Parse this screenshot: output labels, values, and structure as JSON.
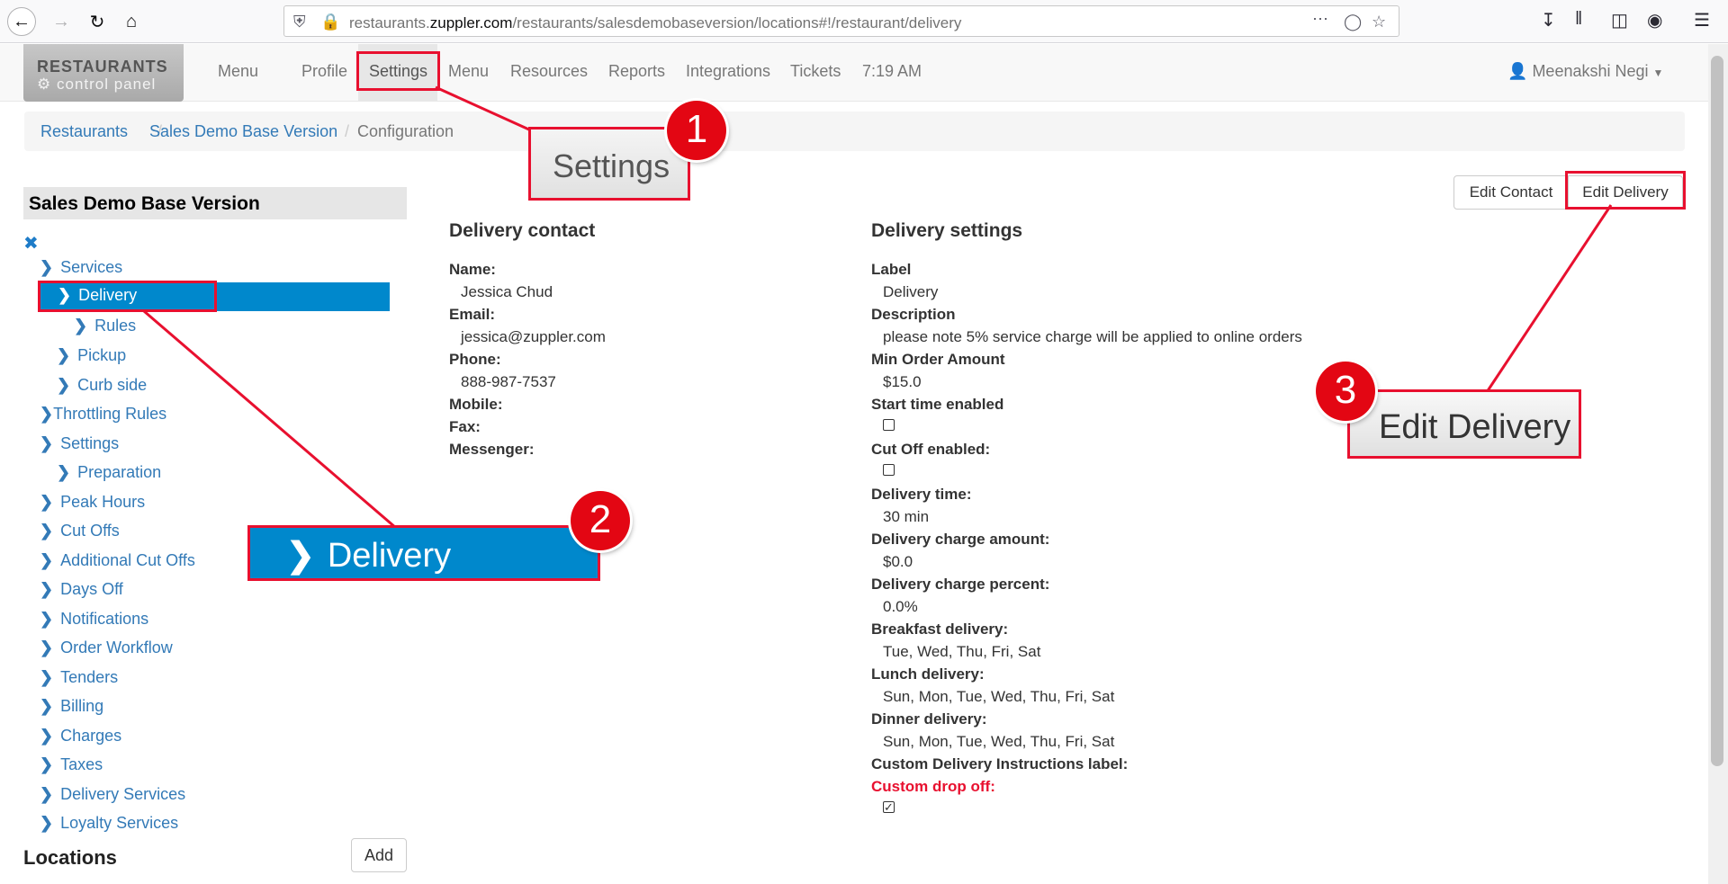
{
  "browser": {
    "url_prefix": "restaurants.",
    "url_domain": "zuppler.com",
    "url_path": "/restaurants/salesdemobaseversion/locations#!/restaurant/delivery"
  },
  "nav": {
    "brand_title": "RESTAURANTS",
    "brand_sub": "control panel",
    "items": [
      "Menu",
      "Profile",
      "Settings",
      "Menu",
      "Resources",
      "Reports",
      "Integrations",
      "Tickets"
    ],
    "time": "7:19 AM",
    "user": "Meenakshi Negi"
  },
  "breadcrumb": {
    "items": [
      "Restaurants",
      "Sales Demo Base Version",
      "Configuration"
    ],
    "separator": "/"
  },
  "sidebar": {
    "title": "Sales Demo Base Version",
    "items": [
      {
        "label": "Services"
      },
      {
        "label": "Delivery"
      },
      {
        "label": "Rules"
      },
      {
        "label": "Pickup"
      },
      {
        "label": "Curb side"
      },
      {
        "label": "Throttling Rules"
      },
      {
        "label": "Settings"
      },
      {
        "label": "Preparation"
      },
      {
        "label": "Peak Hours"
      },
      {
        "label": "Cut Offs"
      },
      {
        "label": "Additional Cut Offs"
      },
      {
        "label": "Days Off"
      },
      {
        "label": "Notifications"
      },
      {
        "label": "Order Workflow"
      },
      {
        "label": "Tenders"
      },
      {
        "label": "Billing"
      },
      {
        "label": "Charges"
      },
      {
        "label": "Taxes"
      },
      {
        "label": "Delivery Services"
      },
      {
        "label": "Loyalty Services"
      }
    ],
    "locations_title": "Locations",
    "add_label": "Add"
  },
  "contact": {
    "title": "Delivery contact",
    "fields": [
      {
        "label": "Name:",
        "value": "Jessica Chud"
      },
      {
        "label": "Email:",
        "value": "jessica@zuppler.com"
      },
      {
        "label": "Phone:",
        "value": "888-987-7537"
      },
      {
        "label": "Mobile:",
        "value": ""
      },
      {
        "label": "Fax:",
        "value": ""
      },
      {
        "label": "Messenger:",
        "value": ""
      }
    ]
  },
  "settings": {
    "title": "Delivery settings",
    "fields": [
      {
        "label": "Label",
        "value": "Delivery"
      },
      {
        "label": "Description",
        "value": "please note 5% service charge will be applied to online orders"
      },
      {
        "label": "Min Order Amount",
        "value": "$15.0"
      },
      {
        "label": "Start time enabled",
        "checked": false
      },
      {
        "label": "Cut Off enabled:",
        "checked": false
      },
      {
        "label": "Delivery time:",
        "value": "30 min"
      },
      {
        "label": "Delivery charge amount:",
        "value": "$0.0"
      },
      {
        "label": "Delivery charge percent:",
        "value": "0.0%"
      },
      {
        "label": "Breakfast delivery:",
        "value": "Tue, Wed, Thu, Fri, Sat"
      },
      {
        "label": "Lunch delivery:",
        "value": "Sun, Mon, Tue, Wed, Thu, Fri, Sat"
      },
      {
        "label": "Dinner delivery:",
        "value": "Sun, Mon, Tue, Wed, Thu, Fri, Sat"
      },
      {
        "label": "Custom Delivery Instructions label:",
        "value": ""
      },
      {
        "label": "Custom drop off:",
        "checked": true
      }
    ]
  },
  "actions": {
    "edit_contact": "Edit Contact",
    "edit_delivery": "Edit Delivery"
  },
  "annotations": {
    "callout_1": "Settings",
    "callout_2": "Delivery",
    "callout_3": "Edit Delivery",
    "badges": [
      "1",
      "2",
      "3"
    ],
    "color": "#e8102f"
  },
  "colors": {
    "link": "#337ab7",
    "selected_bg": "#0088cc",
    "warning_label": "#e8102f"
  }
}
